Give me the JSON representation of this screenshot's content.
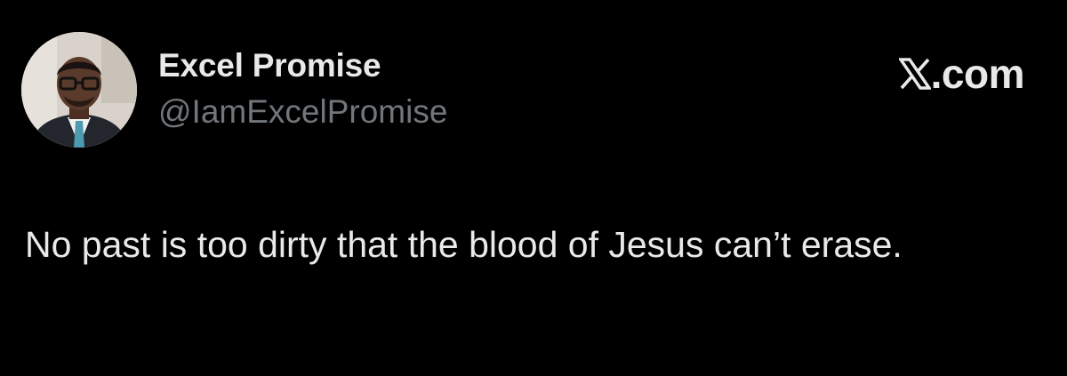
{
  "author": {
    "display_name": "Excel Promise",
    "handle": "@IamExcelPromise"
  },
  "brand": {
    "icon": "x-logo-icon",
    "suffix": ".com"
  },
  "tweet": {
    "text": "No past is too dirty that the blood of Jesus can’t erase."
  },
  "colors": {
    "background": "#000000",
    "primary_text": "#e7e9ea",
    "secondary_text": "#71767b"
  }
}
